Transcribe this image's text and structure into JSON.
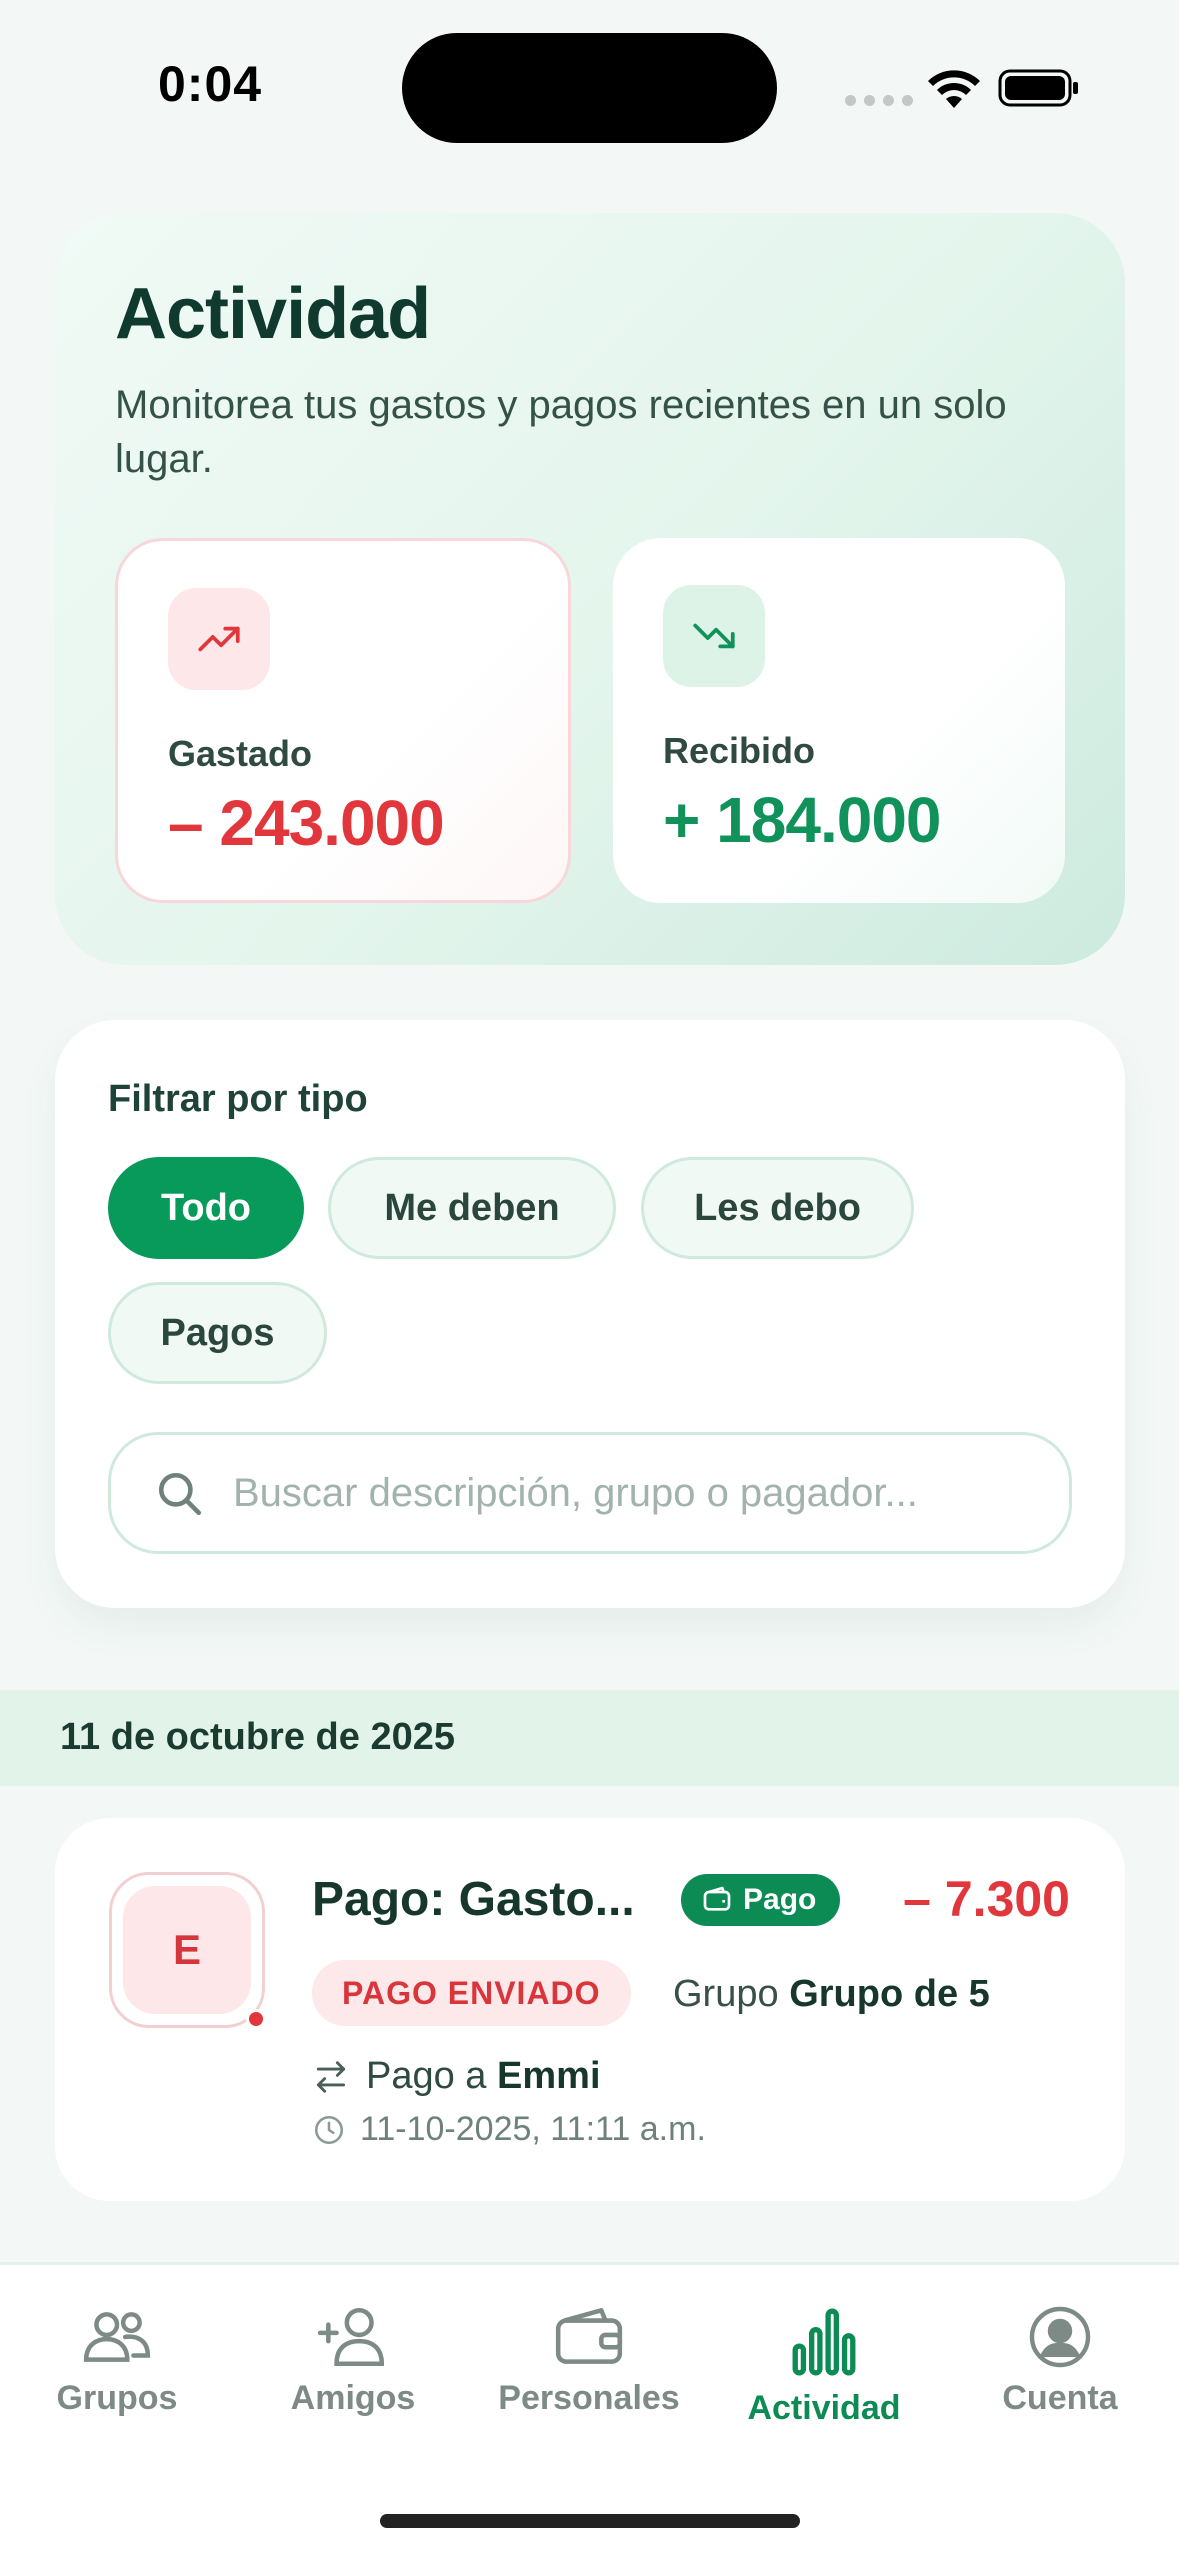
{
  "status_bar": {
    "time": "0:04"
  },
  "hero": {
    "title": "Actividad",
    "subtitle": "Monitorea tus gastos y pagos recientes en un solo lugar.",
    "spent": {
      "label": "Gastado",
      "value": "– 243.000",
      "icon": "trending-up-icon"
    },
    "received": {
      "label": "Recibido",
      "value": "+ 184.000",
      "icon": "trending-down-icon"
    }
  },
  "filter": {
    "label": "Filtrar por tipo",
    "chips": [
      "Todo",
      "Me deben",
      "Les debo",
      "Pagos"
    ],
    "selected": "Todo",
    "search_placeholder": "Buscar descripción, grupo o pagador...",
    "search_value": ""
  },
  "activity": {
    "date_header": "11 de octubre de 2025",
    "items": [
      {
        "avatar_letter": "E",
        "title": "Pago: Gasto...",
        "type_badge": "Pago",
        "amount": "– 7.300",
        "status": "PAGO ENVIADO",
        "group_prefix": "Grupo",
        "group_name": "Grupo de 5",
        "payee_prefix": "Pago a",
        "payee_name": "Emmi",
        "timestamp": "11-10-2025, 11:11 a.m."
      }
    ]
  },
  "tab_bar": {
    "tabs": [
      {
        "label": "Grupos",
        "icon": "users-icon"
      },
      {
        "label": "Amigos",
        "icon": "add-user-icon"
      },
      {
        "label": "Personales",
        "icon": "wallet-icon"
      },
      {
        "label": "Actividad",
        "icon": "bar-chart-icon"
      },
      {
        "label": "Cuenta",
        "icon": "account-icon"
      }
    ],
    "active": "Actividad"
  },
  "colors": {
    "accent": "#079a5a",
    "spent": "#e0363c",
    "received": "#11925a",
    "background": "#f3f8f6"
  }
}
